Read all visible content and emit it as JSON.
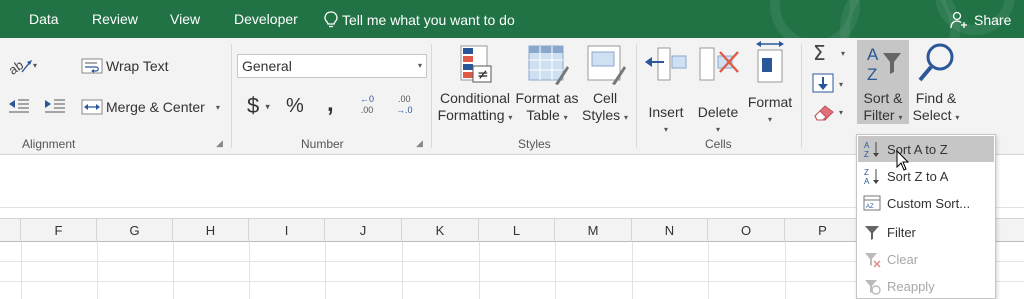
{
  "tabs": [
    "Data",
    "Review",
    "View",
    "Developer"
  ],
  "tell_me": "Tell me what you want to do",
  "share": "Share",
  "alignment": {
    "wrap_text": "Wrap Text",
    "merge_center": "Merge & Center",
    "group_label": "Alignment"
  },
  "number": {
    "format_value": "General",
    "currency": "$",
    "percent": "%",
    "comma": ",",
    "increase_decimal_top": "←0",
    "increase_decimal_bottom": ".00",
    "decrease_decimal_top": ".00",
    "decrease_decimal_bottom": "→.0",
    "group_label": "Number"
  },
  "styles": {
    "conditional_line1": "Conditional",
    "conditional_line2": "Formatting",
    "format_table_line1": "Format as",
    "format_table_line2": "Table",
    "cell_styles_line1": "Cell",
    "cell_styles_line2": "Styles",
    "group_label": "Styles"
  },
  "cells": {
    "insert": "Insert",
    "delete": "Delete",
    "format": "Format",
    "group_label": "Cells"
  },
  "editing": {
    "sort_filter_line1": "Sort &",
    "sort_filter_line2": "Filter",
    "find_select_line1": "Find &",
    "find_select_line2": "Select"
  },
  "columns": [
    "F",
    "G",
    "H",
    "I",
    "J",
    "K",
    "L",
    "M",
    "N",
    "O",
    "P"
  ],
  "sort_menu": {
    "items": [
      {
        "label": "Sort A to Z",
        "icon": "sort-a-to-z-icon",
        "state": "hover"
      },
      {
        "label": "Sort Z to A",
        "icon": "sort-z-to-a-icon",
        "state": "normal"
      },
      {
        "label": "Custom Sort...",
        "icon": "custom-sort-icon",
        "state": "normal"
      },
      {
        "label": "Filter",
        "icon": "filter-icon",
        "state": "normal"
      },
      {
        "label": "Clear",
        "icon": "clear-filter-icon",
        "state": "disabled"
      },
      {
        "label": "Reapply",
        "icon": "reapply-icon",
        "state": "disabled"
      }
    ]
  },
  "colors": {
    "brand": "#217346",
    "ribbon_bg": "#f3f3f3",
    "menu_hover": "#c6c6c6",
    "disabled_text": "#a8a8a8"
  }
}
